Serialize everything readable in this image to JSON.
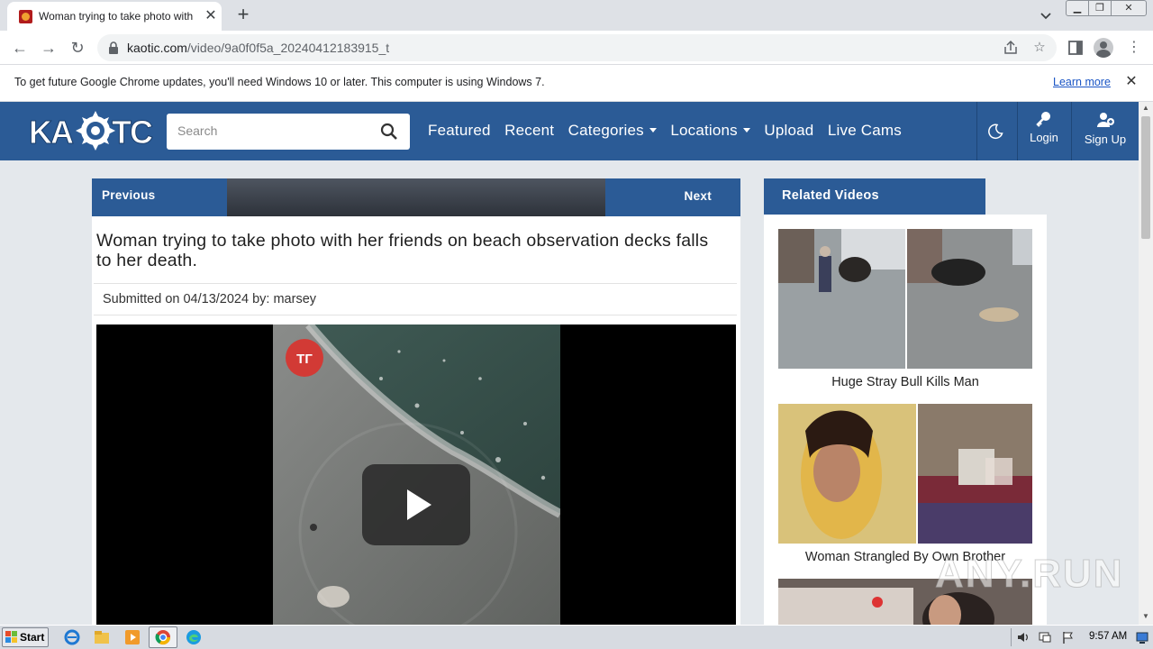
{
  "browser": {
    "tab_title": "Woman trying to take photo with her friends",
    "url_host": "kaotic.com",
    "url_path": "/video/9a0f0f5a_20240412183915_t"
  },
  "infobar": {
    "message": "To get future Google Chrome updates, you'll need Windows 10 or later. This computer is using Windows 7.",
    "learn_more": "Learn more"
  },
  "site": {
    "search_placeholder": "Search",
    "nav": {
      "featured": "Featured",
      "recent": "Recent",
      "categories": "Categories",
      "locations": "Locations",
      "upload": "Upload",
      "live_cams": "Live Cams"
    },
    "login": "Login",
    "signup": "Sign Up"
  },
  "video": {
    "previous": "Previous",
    "next": "Next",
    "title": "Woman trying to take photo with her friends on beach observation decks falls to her death.",
    "submitted_label": "Submitted on",
    "submitted_date": "04/13/2024",
    "by_label": "by:",
    "author": "marsey"
  },
  "related": {
    "heading": "Related Videos",
    "items": [
      {
        "title": "Huge Stray Bull Kills Man"
      },
      {
        "title": "Woman Strangled By Own Brother"
      }
    ]
  },
  "watermark": "ANY.RUN",
  "taskbar": {
    "start": "Start",
    "time": "9:57 AM"
  },
  "colors": {
    "site_blue": "#2b5b96",
    "page_bg": "#e4e8ec"
  }
}
